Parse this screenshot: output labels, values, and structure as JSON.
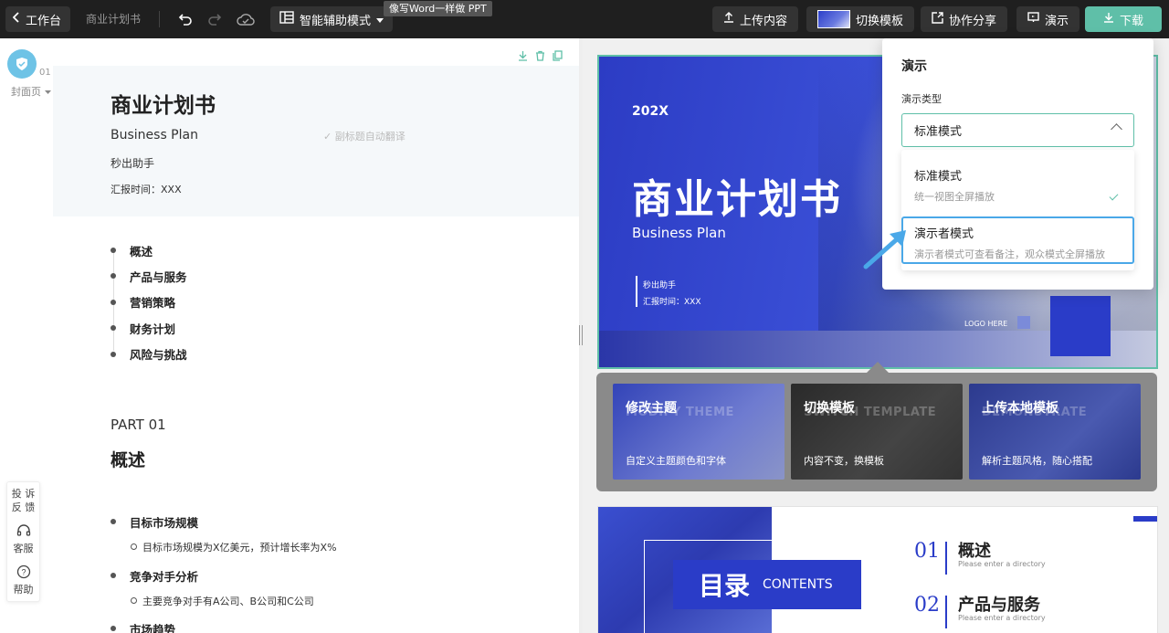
{
  "topbar": {
    "back_label": "工作台",
    "doc_title": "商业计划书",
    "mode_label": "智能辅助模式",
    "tooltip": "像写Word一样做 PPT",
    "upload_label": "上传内容",
    "switch_template_label": "切换模板",
    "share_label": "协作分享",
    "present_label": "演示",
    "download_label": "下载",
    "accent_color": "#5fbfa8"
  },
  "editor": {
    "page_number": "01",
    "page_type": "封面页",
    "cover": {
      "title": "商业计划书",
      "subtitle": "Business Plan",
      "auto_translate": "✓ 副标题自动翻译",
      "author": "秒出助手",
      "date": "汇报时间：XXX"
    },
    "outline": [
      "概述",
      "产品与服务",
      "营销策略",
      "财务计划",
      "风险与挑战"
    ],
    "part": {
      "label": "PART 01",
      "title": "概述"
    },
    "bullets": [
      {
        "title": "目标市场规模",
        "sub": "目标市场规模为X亿美元，预计增长率为X%"
      },
      {
        "title": "竞争对手分析",
        "sub": "主要竞争对手有A公司、B公司和C公司"
      },
      {
        "title": "市场趋势"
      }
    ]
  },
  "feedback": {
    "complain": "投 诉 反 馈",
    "service": "客服",
    "help": "帮助"
  },
  "slide1": {
    "year": "202X",
    "title": "商业计划书",
    "subtitle": "Business Plan",
    "author": "秒出助手",
    "date": "汇报时间：XXX",
    "logo": "LOGO HERE"
  },
  "popover": {
    "cards": [
      {
        "title": "修改主题",
        "bg_text": "MODIFY THEME",
        "desc": "自定义主题颜色和字体"
      },
      {
        "title": "切换模板",
        "bg_text": "SWITCH TEMPLATE",
        "desc": "内容不变，换模板"
      },
      {
        "title": "上传本地模板",
        "bg_text": "DEMONSTRATE",
        "desc": "解析主题风格，随心搭配"
      }
    ]
  },
  "slide2": {
    "big": "目录",
    "small": "CONTENTS",
    "items": [
      {
        "num": "01",
        "title": "概述",
        "hint": "Please enter a directory"
      },
      {
        "num": "02",
        "title": "产品与服务",
        "hint": "Please enter a directory"
      }
    ]
  },
  "present_panel": {
    "title": "演示",
    "type_label": "演示类型",
    "selected": "标准模式",
    "options": [
      {
        "name": "标准模式",
        "desc": "统一视图全屏播放"
      },
      {
        "name": "演示者模式",
        "desc": "演示者模式可查看备注，观众模式全屏播放"
      }
    ]
  }
}
